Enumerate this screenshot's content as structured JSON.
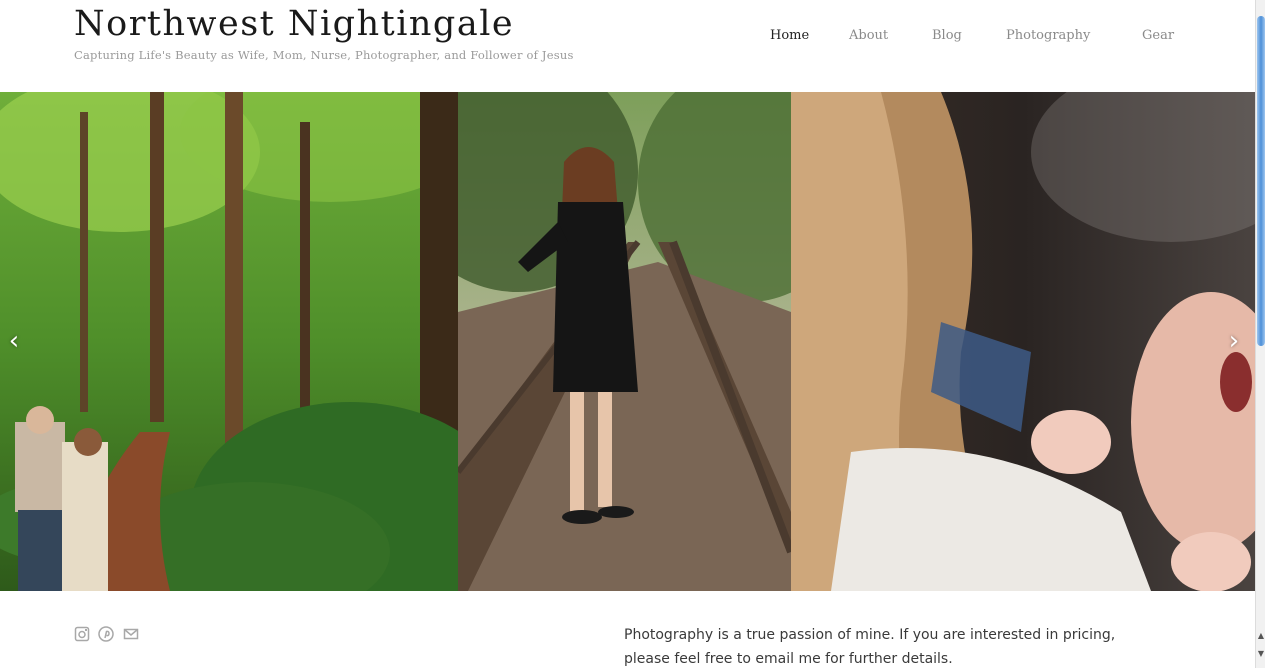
{
  "site": {
    "title": "Northwest Nightingale",
    "tagline": "Capturing Life's Beauty as Wife, Mom, Nurse, Photographer, and Follower of Jesus"
  },
  "nav": {
    "items": [
      {
        "label": "Home",
        "active": true
      },
      {
        "label": "About",
        "active": false
      },
      {
        "label": "Blog",
        "active": false
      },
      {
        "label": "Photography",
        "active": false
      },
      {
        "label": "Gear",
        "active": false
      }
    ]
  },
  "gallery": {
    "prev_icon": "chevron-left-icon",
    "next_icon": "chevron-right-icon",
    "photos": [
      "couple-in-forest",
      "pregnant-woman-on-railroad-tracks",
      "newborn-baby"
    ]
  },
  "social": {
    "icons": [
      "instagram-icon",
      "pinterest-icon",
      "email-icon"
    ]
  },
  "intro": {
    "text": "Photography is a true passion of mine. If you are interested in pricing, please feel free to email me for further details."
  },
  "colors": {
    "title": "#1a1a1a",
    "tagline": "#9a9a9a",
    "nav": "#8a8a8a",
    "nav_active": "#222222",
    "body_text": "#3a3a3a"
  }
}
